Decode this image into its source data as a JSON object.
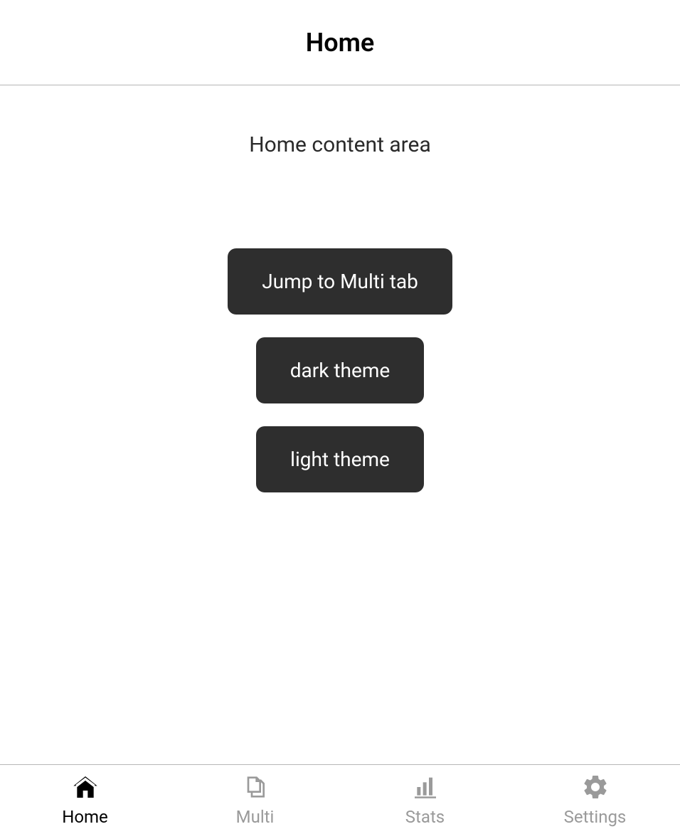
{
  "header": {
    "title": "Home"
  },
  "content": {
    "description": "Home content area",
    "buttons": {
      "jump_multi": "Jump to Multi tab",
      "dark_theme": "dark theme",
      "light_theme": "light theme"
    }
  },
  "tabbar": {
    "tabs": [
      {
        "label": "Home",
        "icon": "home-icon",
        "active": true
      },
      {
        "label": "Multi",
        "icon": "copy-icon",
        "active": false
      },
      {
        "label": "Stats",
        "icon": "stats-icon",
        "active": false
      },
      {
        "label": "Settings",
        "icon": "gear-icon",
        "active": false
      }
    ]
  }
}
